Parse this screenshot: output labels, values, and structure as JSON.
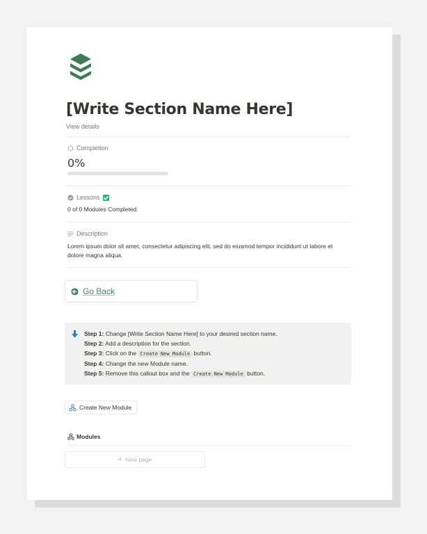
{
  "page": {
    "title": "[Write Section Name Here]",
    "view_details": "View details"
  },
  "completion": {
    "label": "Completion",
    "value_text": "0%",
    "progress": 0
  },
  "lessons": {
    "label": "Lessons",
    "modules_text": "0 of 0 Modules Completed."
  },
  "description": {
    "label": "Description",
    "text": "Lorem ipsum dolor sit amet, consectetur adipiscing elit, sed do eiusmod tempor incididunt ut labore et dolore magna aliqua."
  },
  "go_back": {
    "label": "Go Back"
  },
  "callout": {
    "steps": [
      {
        "label": "Step 1:",
        "text": "Change [Write Section Name Here] to your desired section name."
      },
      {
        "label": "Step 2:",
        "text": "Add a description for the section."
      },
      {
        "label": "Step 3:",
        "pre": "Click on the",
        "code": "Create New Module",
        "post": "button."
      },
      {
        "label": "Step 4:",
        "text": "Change the new Module name."
      },
      {
        "label": "Step 5:",
        "pre": "Remove this callout box and the",
        "code": "Create New Module",
        "post": "button."
      }
    ]
  },
  "create_module_button": {
    "label": "Create New Module"
  },
  "modules": {
    "heading": "Modules",
    "new_page": "New page"
  },
  "colors": {
    "accent_green": "#448361",
    "icon_blue": "#2f7fc1",
    "check_green": "#2eb67d",
    "callout_bg": "#f1f1ef"
  },
  "icons": {
    "logo": "stack-layers-icon",
    "completion": "loading-circle-icon",
    "lessons": "check-circle-icon",
    "description": "text-lines-icon",
    "go_back": "arrow-left-circle-icon",
    "callout": "arrow-down-icon",
    "create_module": "hierarchy-icon",
    "modules": "hierarchy-icon",
    "new_page": "plus-icon"
  }
}
